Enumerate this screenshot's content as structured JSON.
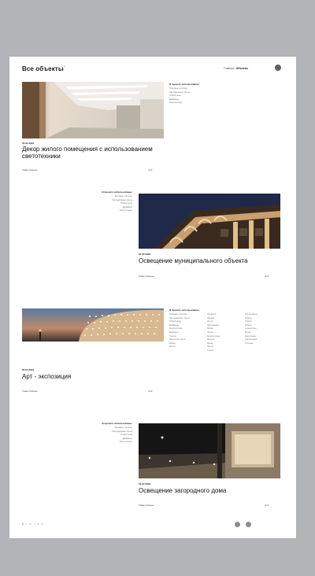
{
  "header": {
    "title": "Все объекты",
    "title_mark": "^",
    "breadcrumb_prefix": "Главная /",
    "breadcrumb_current": "Объекты"
  },
  "projects": [
    {
      "date": "01.01.2019",
      "title": "Декор жилого помещения с использованием светотехники",
      "more": "Узнать больше",
      "count": "4/12",
      "used_title": "В проекте использованы:",
      "used_cols": [
        [
          "Трековые системы",
          "Светодиодные ленты",
          "Гибкий неон",
          "Драйверы",
          "Контроллеры"
        ]
      ]
    },
    {
      "date": "01.07.2019",
      "title": "Освещение муниципального объекта",
      "more": "Узнать больше",
      "count": "4/12",
      "used_title": "В проекте использованы:",
      "used_cols": [
        [
          "Трековые системы",
          "Светодиодные ленты",
          "Гибкий неон",
          "Драйверы",
          "Контроллеры"
        ]
      ]
    },
    {
      "date": "01.07.2019",
      "title": "Арт - экспозиция",
      "more": "Узнать больше",
      "count": "4/12",
      "used_title": "В проекте использованы:",
      "used_cols": [
        [
          "Трековые системы",
          "Светодиодные ленты",
          "Гибкий неон",
          "Драйверы",
          "Контроллеры",
          "Диммеры",
          "Пульты",
          "Линзы для ленты",
          "Фасад",
          "Ленты"
        ],
        [
          "Профили",
          "Экраны",
          "Ленты",
          "Светодиоды",
          "Фасад",
          "Ленты",
          "Контроллеры",
          "Модули",
          "Фасад",
          "Ленты",
          "Стекло"
        ],
        [
          "Интерьерные",
          "Кабели",
          "Стекло",
          "Кабели",
          "Коннекторы",
          "Блоки",
          "Аксессуары",
          "Светильники",
          "Уличные"
        ]
      ]
    },
    {
      "date": "01.07.2019",
      "title": "Освещение загородного дома",
      "more": "Узнать больше",
      "count": "4/12",
      "used_title": "В проекте использованы:",
      "used_cols": [
        [
          "Трековые системы",
          "Светодиодные ленты",
          "Гибкий неон",
          "Драйверы",
          "Контроллеры"
        ]
      ]
    }
  ],
  "footer": {
    "logo": "B I O L A N"
  },
  "colors": {
    "background": "#b2b4b8",
    "page": "#ffffff",
    "text": "#1a1a1a",
    "muted": "#777777",
    "dot": "#8a8b8f"
  }
}
